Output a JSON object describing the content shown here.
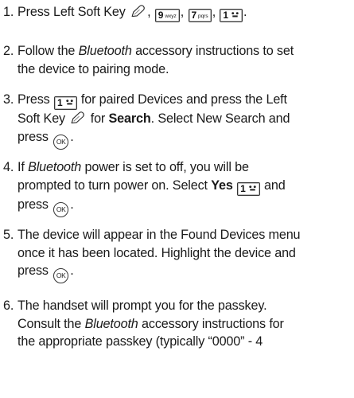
{
  "steps": [
    {
      "num": "1.",
      "text_a": "Press Left Soft Key",
      "sep1": ",",
      "sep2": ",",
      "sep3": ",",
      "end": ".",
      "keys": [
        {
          "label": "9",
          "sub": "wxyz"
        },
        {
          "label": "7",
          "sub": "pqrs"
        },
        {
          "label": "1",
          "glyph": "voicemail"
        }
      ]
    },
    {
      "num": "2.",
      "text_a": "Follow the",
      "em": "Bluetooth",
      "text_b": "accessory instructions to set",
      "line2": "the device to pairing mode."
    },
    {
      "num": "3.",
      "text_a": "Press",
      "text_b": "for paired Devices and press the Left",
      "line2_a": "Soft Key",
      "line2_b": "for",
      "line2_bold": "Search",
      "line2_c": ". Select New Search and",
      "line3": "press",
      "line3_end": ".",
      "key": {
        "label": "1",
        "glyph": "voicemail"
      },
      "ok_label": "OK"
    },
    {
      "num": "4.",
      "text_a": "If",
      "em": "Bluetooth",
      "text_b": "power is set to off, you will be",
      "line2": "prompted to turn power on. Select",
      "line2_bold": "Yes",
      "line2_c": "and",
      "line3": "press",
      "line3_end": ".",
      "key": {
        "label": "1",
        "glyph": "voicemail"
      },
      "ok_label": "OK"
    },
    {
      "num": "5.",
      "line1": "The device will appear in the Found Devices menu",
      "line2": "once it has been located. Highlight the device and",
      "line3": "press",
      "line3_end": ".",
      "ok_label": "OK"
    },
    {
      "num": "6.",
      "line1": "The handset will prompt you for the passkey.",
      "line2_a": "Consult the",
      "em": "Bluetooth",
      "line2_b": "accessory instructions for",
      "line3": "the appropriate passkey (typically “0000” - 4"
    }
  ],
  "icons": {
    "soft_key": "left-soft-key-icon",
    "ok_key": "ok-key-icon",
    "voicemail_glyph": "voicemail-icon"
  }
}
